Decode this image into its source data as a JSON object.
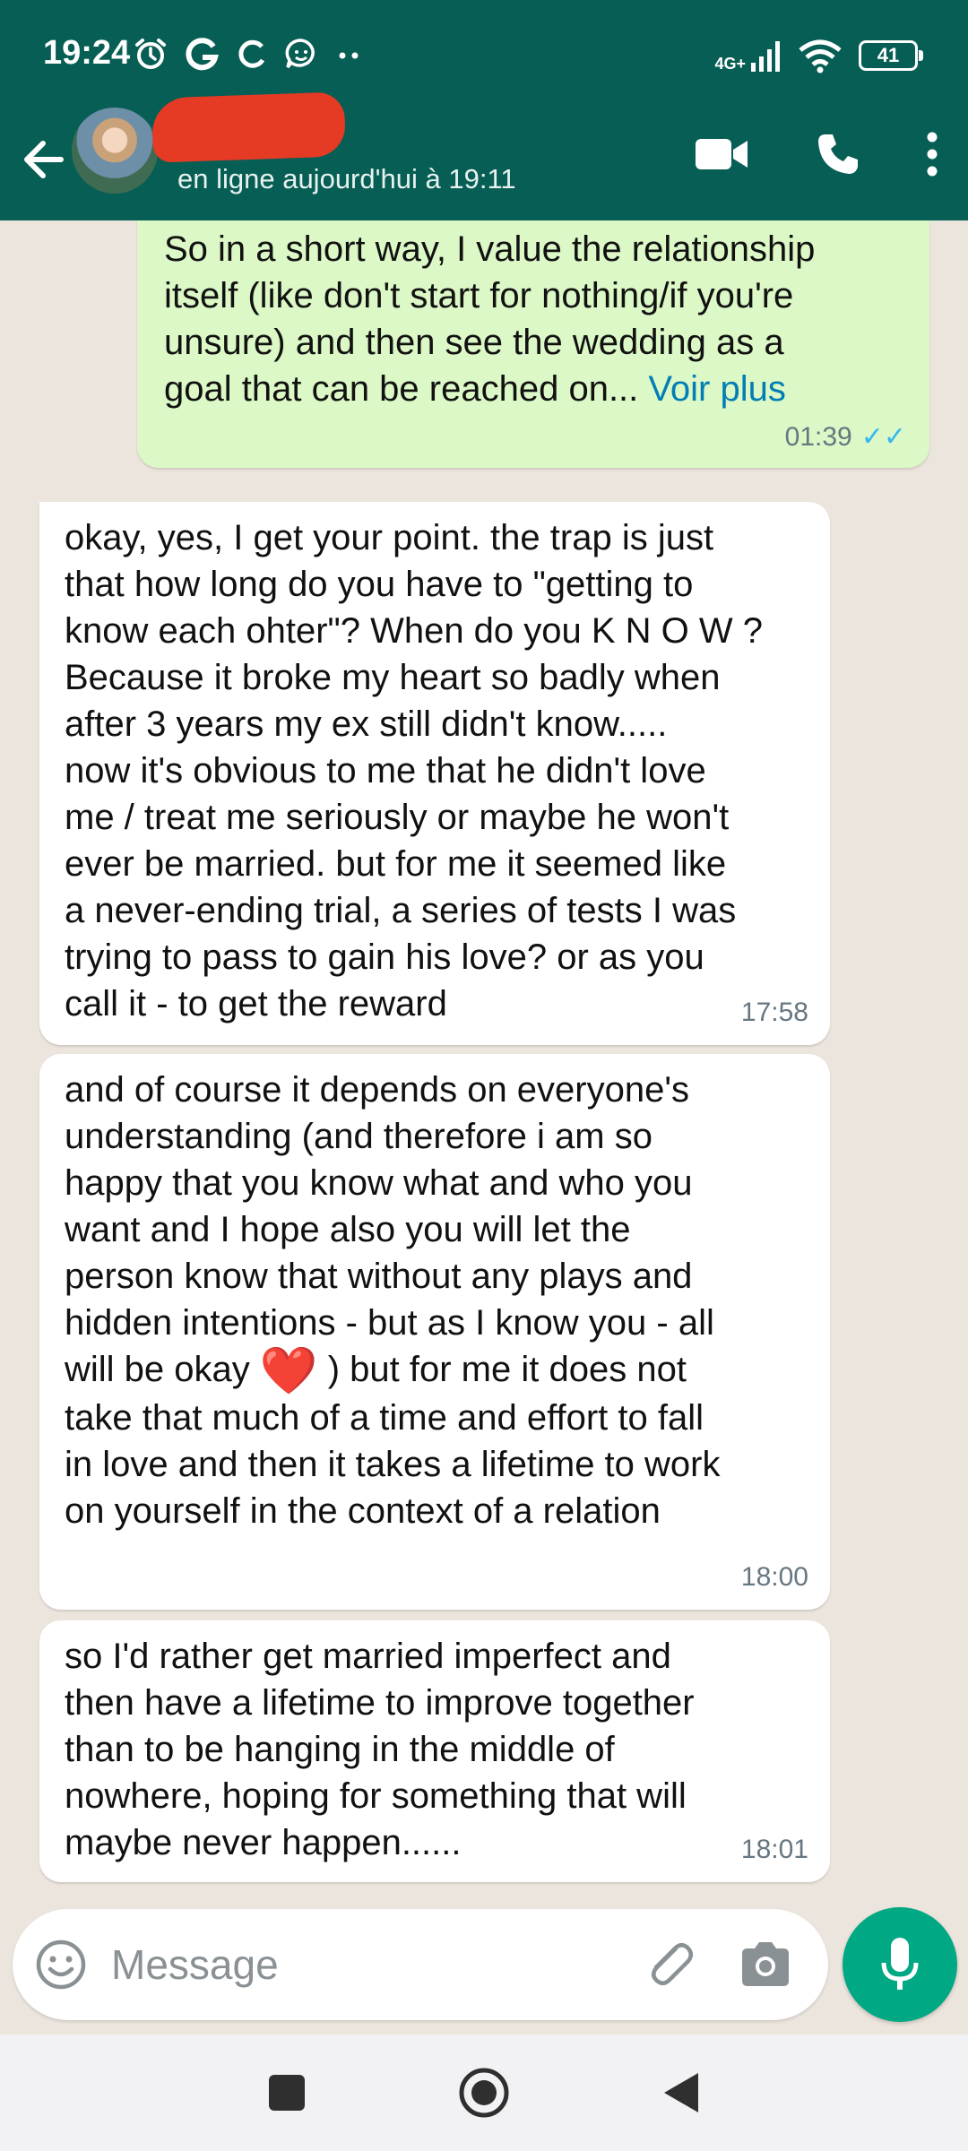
{
  "status_bar": {
    "time": "19:24",
    "left_icons": [
      "alarm-icon",
      "google-icon",
      "sync-icon",
      "chat-bubble-icon",
      "more-dots-icon"
    ],
    "network": "4G+",
    "battery": "41"
  },
  "header": {
    "contact_status": "en ligne aujourd'hui à 19:11",
    "actions": [
      "video-call-icon",
      "voice-call-icon",
      "overflow-menu-icon"
    ]
  },
  "messages": [
    {
      "direction": "outgoing",
      "text": "So in a short way, I value the relationship\nitself (like don't start for nothing/if you're\nunsure) and then see the wedding as a\ngoal that can be reached on...",
      "more_label": "Voir plus",
      "time": "01:39",
      "read": true
    },
    {
      "direction": "incoming",
      "text": "okay, yes, I get your point. the trap is just\nthat how long do you have to \"getting to\nknow each ohter\"? When do you K N O W ?\nBecause it broke my heart so badly when\nafter 3 years my ex still didn't know.....\nnow it's obvious to me that he didn't love\nme / treat me seriously or maybe he won't\never be married. but for me it seemed like\na never-ending trial, a series of tests I was\ntrying to pass to gain his love? or as you\ncall it - to get the reward",
      "time": "17:58"
    },
    {
      "direction": "incoming",
      "text_before_emoji": "and of course it depends on everyone's\nunderstanding (and therefore i am so\nhappy that you know what and who you\nwant and I hope also you will let the\nperson know that without any plays and\nhidden intentions - but as I know you - all\nwill be okay ",
      "emoji": "❤️",
      "text_after_emoji": " ) but for me it does not\ntake that much of a time and effort to fall\nin love and then it takes a lifetime to work\non yourself in the context of a relation",
      "time": "18:00"
    },
    {
      "direction": "incoming",
      "text": "so I'd rather get married imperfect and\nthen have a lifetime to improve together\nthan to be hanging in the middle of\nnowhere, hoping for something that will\nmaybe never happen......",
      "time": "18:01"
    }
  ],
  "composer": {
    "placeholder": "Message"
  },
  "colors": {
    "header_bg": "#075e54",
    "chat_bg": "#ece5dd",
    "outgoing_bubble": "#dcf8c6",
    "incoming_bubble": "#ffffff",
    "accent": "#00a884",
    "link": "#027eb5",
    "read_ticks": "#34b7f1"
  }
}
